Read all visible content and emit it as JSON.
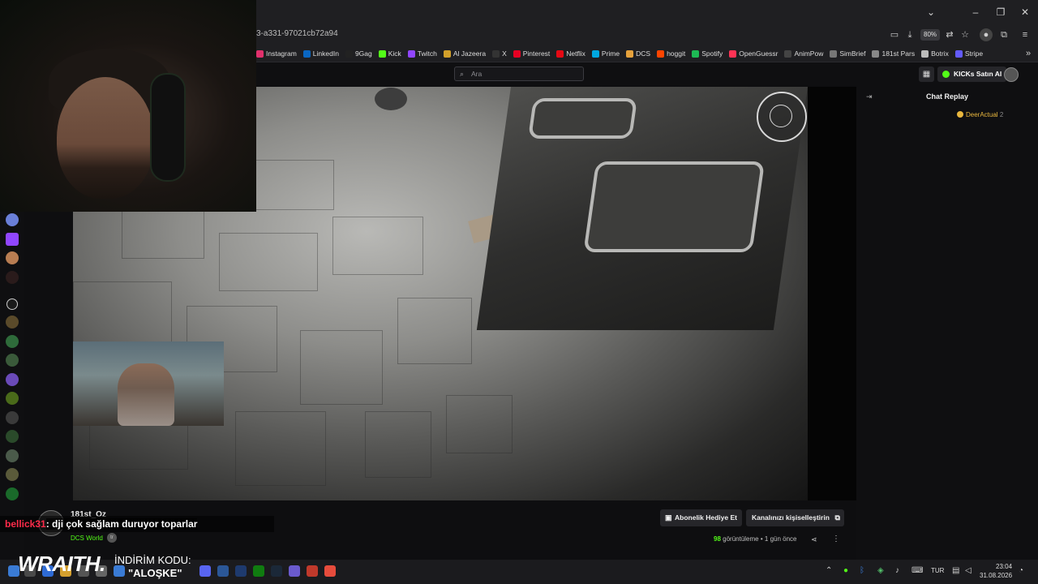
{
  "browser": {
    "url_fragment": "3-a331-97021cb72a94",
    "zoom": "80%",
    "window_buttons": [
      "chevron-down",
      "minimize",
      "restore",
      "close"
    ],
    "bookmarks": [
      {
        "label": "Instagram",
        "color": "#e1306c"
      },
      {
        "label": "LinkedIn",
        "color": "#0a66c2"
      },
      {
        "label": "9Gag",
        "color": "#222222"
      },
      {
        "label": "Kick",
        "color": "#53fc18"
      },
      {
        "label": "Twitch",
        "color": "#9146ff"
      },
      {
        "label": "Al Jazeera",
        "color": "#d2a02a"
      },
      {
        "label": "X",
        "color": "#333333"
      },
      {
        "label": "Pinterest",
        "color": "#e60023"
      },
      {
        "label": "Netflix",
        "color": "#e50914"
      },
      {
        "label": "Prime",
        "color": "#00a8e1"
      },
      {
        "label": "DCS",
        "color": "#e6a23c"
      },
      {
        "label": "hoggit",
        "color": "#ff4500"
      },
      {
        "label": "Spotify",
        "color": "#1db954"
      },
      {
        "label": "OpenGuessr",
        "color": "#ff3355"
      },
      {
        "label": "AnimPow",
        "color": "#444444"
      },
      {
        "label": "SimBrief",
        "color": "#777777"
      },
      {
        "label": "181st Pars",
        "color": "#888888"
      },
      {
        "label": "Botrix",
        "color": "#bbbbbb"
      },
      {
        "label": "Stripe",
        "color": "#635bff"
      }
    ]
  },
  "header": {
    "search_placeholder": "Ara",
    "kicks_button": "KICKs Satın Al"
  },
  "chat": {
    "title": "Chat Replay",
    "user": "DeerActual",
    "user_count": "2"
  },
  "under_video": {
    "gift_button": "Abonelik Hediye Et",
    "customize_button": "Kanalınızı kişiselleştirin",
    "views": "98",
    "views_label": "görüntüleme",
    "ago": "1 gün önce"
  },
  "overlay": {
    "channel_name": "181st_Oz",
    "category": "DCS World",
    "lang_badge": "tr",
    "chat_user": "bellick31",
    "chat_sep": ":",
    "chat_message": "dji çok sağlam duruyor toparlar",
    "sponsor": "WRAITH.",
    "promo_label": "İNDİRİM KODU:",
    "promo_code": "\"ALOŞKE\""
  },
  "taskbar": {
    "lang": "TUR",
    "time": "23:04",
    "date": "31.08.2026"
  }
}
